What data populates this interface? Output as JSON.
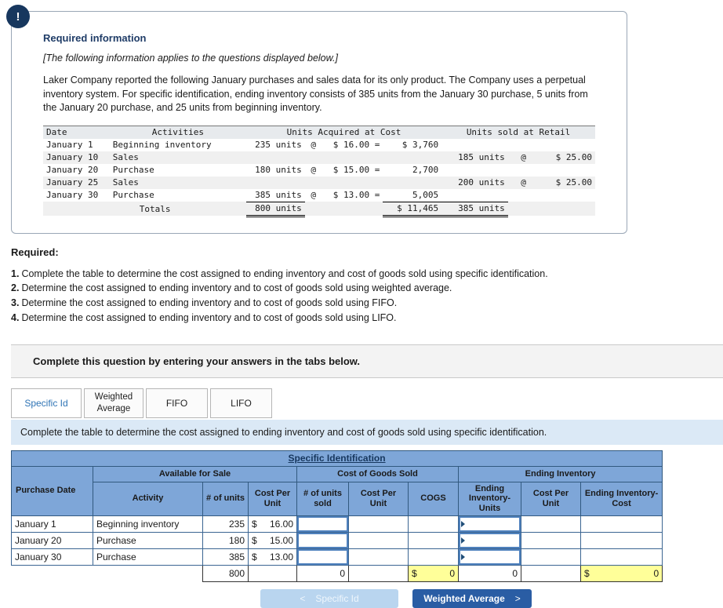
{
  "alert_badge": "!",
  "info_box": {
    "title": "Required information",
    "note": "[The following information applies to the questions displayed below.]",
    "paragraph": "Laker Company reported the following January purchases and sales data for its only product. The Company uses a perpetual inventory system. For specific identification, ending inventory consists of 385 units from the January 30 purchase, 5 units from the January 20 purchase, and 25 units from beginning inventory."
  },
  "inventory_table": {
    "col_date": "Date",
    "col_activities": "Activities",
    "col_acquired": "Units Acquired at Cost",
    "col_sold": "Units sold at Retail",
    "rows": [
      {
        "date": "January 1",
        "activity": "Beginning inventory",
        "qty": "235 units",
        "at": "@",
        "price": "$ 16.00 =",
        "amount": "$ 3,760",
        "sold_qty": "",
        "sold_at": "",
        "sold_price": ""
      },
      {
        "date": "January 10",
        "activity": "Sales",
        "qty": "",
        "at": "",
        "price": "",
        "amount": "",
        "sold_qty": "185 units",
        "sold_at": "@",
        "sold_price": "$ 25.00"
      },
      {
        "date": "January 20",
        "activity": "Purchase",
        "qty": "180 units",
        "at": "@",
        "price": "$ 15.00 =",
        "amount": "2,700",
        "sold_qty": "",
        "sold_at": "",
        "sold_price": ""
      },
      {
        "date": "January 25",
        "activity": "Sales",
        "qty": "",
        "at": "",
        "price": "",
        "amount": "",
        "sold_qty": "200 units",
        "sold_at": "@",
        "sold_price": "$ 25.00"
      },
      {
        "date": "January 30",
        "activity": "Purchase",
        "qty": "385 units",
        "at": "@",
        "price": "$ 13.00 =",
        "amount": "5,005",
        "sold_qty": "",
        "sold_at": "",
        "sold_price": ""
      }
    ],
    "totals": {
      "label": "Totals",
      "qty": "800 units",
      "amount": "$ 11,465",
      "sold_qty": "385 units"
    }
  },
  "required": {
    "label": "Required:",
    "items": [
      {
        "num": "1.",
        "text": "Complete the table to determine the cost assigned to ending inventory and cost of goods sold using specific identification."
      },
      {
        "num": "2.",
        "text": "Determine the cost assigned to ending inventory and to cost of goods sold using weighted average."
      },
      {
        "num": "3.",
        "text": "Determine the cost assigned to ending inventory and to cost of goods sold using FIFO."
      },
      {
        "num": "4.",
        "text": "Determine the cost assigned to ending inventory and to cost of goods sold using LIFO."
      }
    ]
  },
  "band_text": "Complete this question by entering your answers in the tabs below.",
  "tabs": [
    {
      "label": "Specific Id"
    },
    {
      "label": "Weighted Average"
    },
    {
      "label": "FIFO"
    },
    {
      "label": "LIFO"
    }
  ],
  "instruction": "Complete the table to determine the cost assigned to ending inventory and cost of goods sold using specific identification.",
  "spec_table": {
    "title": "Specific Identification",
    "h_purchase_date": "Purchase Date",
    "h_available": "Available for Sale",
    "h_cogs_group": "Cost of Goods Sold",
    "h_ending_group": "Ending Inventory",
    "h_activity": "Activity",
    "h_units": "# of units",
    "h_cost_per_unit": "Cost Per Unit",
    "h_units_sold": "# of units sold",
    "h_cogs": "COGS",
    "h_ending_units": "Ending Inventory-Units",
    "h_ending_cost": "Ending Inventory- Cost",
    "currency": "$",
    "rows": [
      {
        "date": "January 1",
        "activity": "Beginning inventory",
        "units": "235",
        "cost": "16.00"
      },
      {
        "date": "January 20",
        "activity": "Purchase",
        "units": "180",
        "cost": "15.00"
      },
      {
        "date": "January 30",
        "activity": "Purchase",
        "units": "385",
        "cost": "13.00"
      }
    ],
    "totals": {
      "units": "800",
      "units_sold": "0",
      "cogs": "0",
      "ending_units": "0",
      "ending_cost": "0"
    }
  },
  "nav": {
    "prev_chevron": "<",
    "prev_label": "Specific Id",
    "next_label": "Weighted Average",
    "next_chevron": ">"
  }
}
